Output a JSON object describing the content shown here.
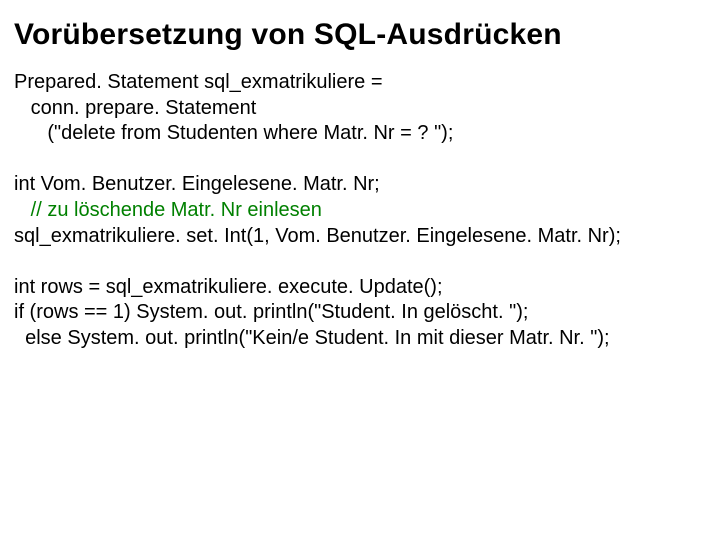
{
  "title": "Vorübersetzung von SQL-Ausdrücken",
  "code": {
    "b1l1": "Prepared. Statement sql_exmatrikuliere =",
    "b1l2": "   conn. prepare. Statement",
    "b1l3": "      (\"delete from Studenten where Matr. Nr = ? \");",
    "b2l1": "int Vom. Benutzer. Eingelesene. Matr. Nr;",
    "b2l2": "   // zu löschende Matr. Nr einlesen",
    "b2l3": "sql_exmatrikuliere. set. Int(1, Vom. Benutzer. Eingelesene. Matr. Nr);",
    "b3l1": "int rows = sql_exmatrikuliere. execute. Update();",
    "b3l2": "if (rows == 1) System. out. println(\"Student. In gelöscht. \");",
    "b3l3": "  else System. out. println(\"Kein/e Student. In mit dieser Matr. Nr. \");"
  }
}
